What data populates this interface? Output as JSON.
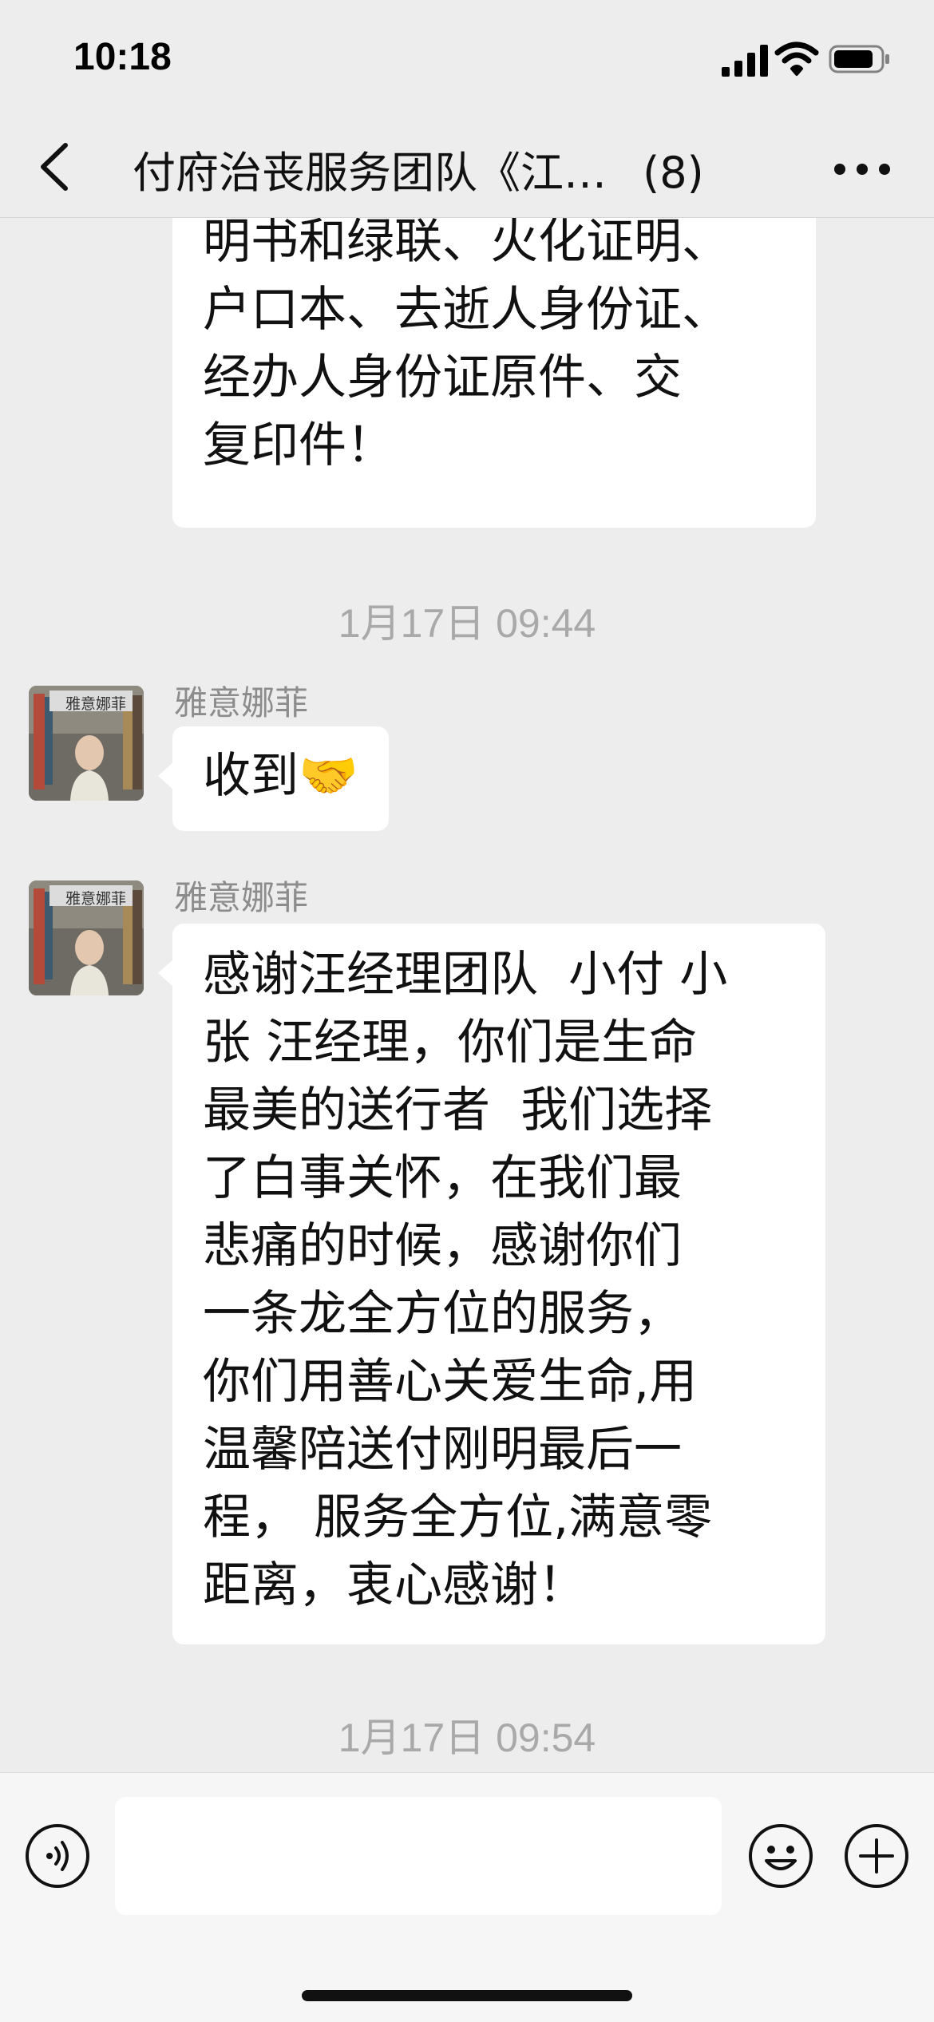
{
  "status_bar": {
    "time": "10:18"
  },
  "nav": {
    "title": "付府治丧服务团队《江…",
    "member_count": "(8)",
    "back_icon": "chevron-left-icon",
    "more_icon": "more-dots-icon"
  },
  "messages": [
    {
      "type": "text",
      "side": "left",
      "partial": true,
      "text": "单位办理，带上死亡证\n明书和绿联、火化证明、\n户口本、去逝人身份证、\n经办人身份证原件、交\n复印件！"
    },
    {
      "type": "timestamp",
      "text": "1月17日 09:44"
    },
    {
      "type": "text",
      "side": "left",
      "sender": "雅意娜菲",
      "avatar_label": "雅意娜菲",
      "text": "收到🤝"
    },
    {
      "type": "text",
      "side": "left",
      "sender": "雅意娜菲",
      "avatar_label": "雅意娜菲",
      "text": "感谢汪经理团队  小付 小\n张 汪经理，你们是生命\n最美的送行者  我们选择\n了白事关怀，在我们最\n悲痛的时候，感谢你们\n一条龙全方位的服务，\n你们用善心关爱生命,用\n温馨陪送付刚明最后一\n程， 服务全方位,满意零\n距离，衷心感谢！"
    },
    {
      "type": "timestamp",
      "text": "1月17日 09:54"
    }
  ],
  "input_bar": {
    "value": "",
    "voice_icon": "voice-icon",
    "emoji_icon": "emoji-icon",
    "plus_icon": "plus-icon"
  },
  "colors": {
    "background": "#ededed",
    "bubble": "#ffffff",
    "timestamp": "#a9a9a9",
    "sender_name": "#8c8c8c"
  }
}
